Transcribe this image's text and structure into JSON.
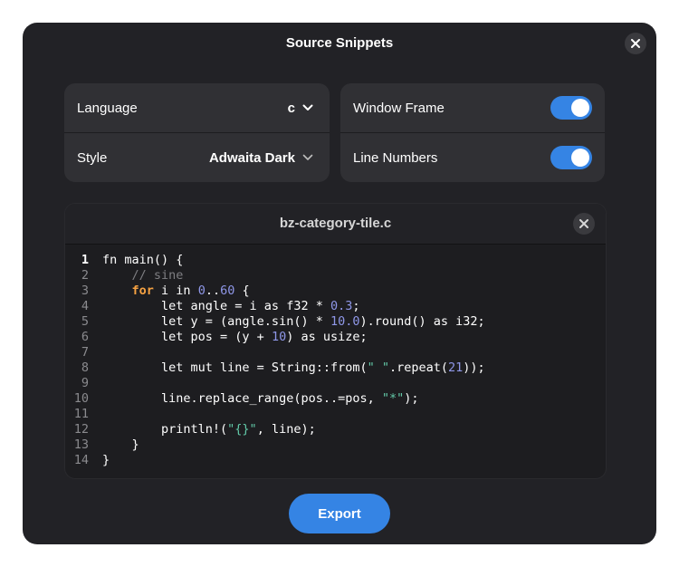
{
  "window": {
    "title": "Source Snippets"
  },
  "settings": {
    "language": {
      "label": "Language",
      "value": "c"
    },
    "style": {
      "label": "Style",
      "value": "Adwaita Dark"
    },
    "window_frame": {
      "label": "Window Frame",
      "enabled": true
    },
    "line_numbers": {
      "label": "Line Numbers",
      "enabled": true
    }
  },
  "preview": {
    "filename": "bz-category-tile.c",
    "lines": [
      {
        "n": "1",
        "code": "fn main() {"
      },
      {
        "n": "2",
        "code": "    // sine"
      },
      {
        "n": "3",
        "code": "    for i in 0..60 {"
      },
      {
        "n": "4",
        "code": "        let angle = i as f32 * 0.3;"
      },
      {
        "n": "5",
        "code": "        let y = (angle.sin() * 10.0).round() as i32;"
      },
      {
        "n": "6",
        "code": "        let pos = (y + 10) as usize;"
      },
      {
        "n": "7",
        "code": ""
      },
      {
        "n": "8",
        "code": "        let mut line = String::from(\" \".repeat(21));"
      },
      {
        "n": "9",
        "code": ""
      },
      {
        "n": "10",
        "code": "        line.replace_range(pos..=pos, \"*\");"
      },
      {
        "n": "11",
        "code": ""
      },
      {
        "n": "12",
        "code": "        println!(\"{}\", line);"
      },
      {
        "n": "13",
        "code": "    }"
      },
      {
        "n": "14",
        "code": "}"
      }
    ]
  },
  "footer": {
    "export_label": "Export"
  },
  "colors": {
    "accent": "#3584e4",
    "keyword": "#f6a242",
    "number": "#8f97e8",
    "string": "#62c9a8",
    "comment": "#7e7e82"
  }
}
